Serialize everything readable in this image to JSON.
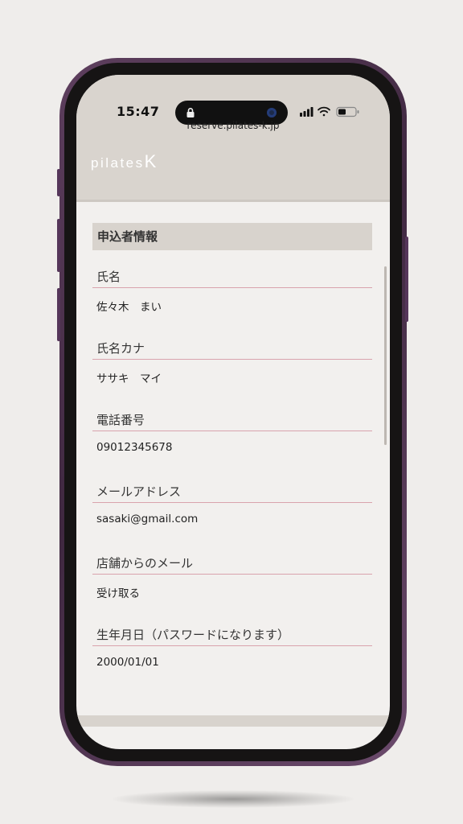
{
  "status_bar": {
    "time": "15:47"
  },
  "browser": {
    "url": "reserve.pilates-k.jp"
  },
  "site": {
    "logo_text": "pilates",
    "logo_mark": "K"
  },
  "section": {
    "title": "申込者情報"
  },
  "fields": [
    {
      "label": "氏名",
      "value": "佐々木　まい"
    },
    {
      "label": "氏名カナ",
      "value": "ササキ　マイ"
    },
    {
      "label": "電話番号",
      "value": "09012345678"
    },
    {
      "label": "メールアドレス",
      "value": "sasaki@gmail.com"
    },
    {
      "label": "店舗からのメール",
      "value": "受け取る"
    },
    {
      "label": "生年月日（パスワードになります）",
      "value": "2000/01/01"
    }
  ],
  "colors": {
    "header_bg": "#d9d4ce",
    "page_bg": "#f2f0ee",
    "underline": "#d9a3ad",
    "frame": "#4a2f4c"
  }
}
